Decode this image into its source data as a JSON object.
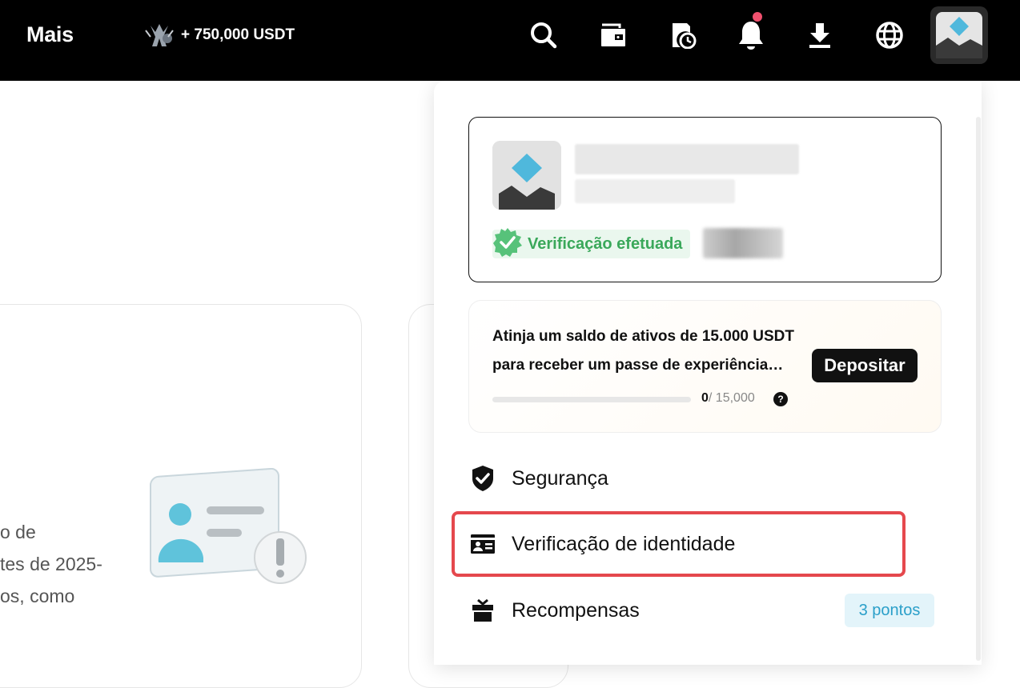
{
  "header": {
    "nav_more": "Mais",
    "promo_text": "+ 750,000 USDT",
    "icons": [
      "search-icon",
      "wallet-icon",
      "order-history-icon",
      "bell-icon",
      "download-icon",
      "globe-icon",
      "avatar"
    ],
    "notification_dot_color": "#f0506e"
  },
  "background": {
    "text_lines": [
      "o de",
      "tes de 2025-",
      "os, como"
    ]
  },
  "profile": {
    "verified_label": "Verificação efetuada",
    "verified_color": "#3aa85a"
  },
  "promo_card": {
    "line1": "Atinja um saldo de ativos de 15.000 USDT",
    "line2": "para receber um passe de experiência…",
    "button_label": "Depositar",
    "progress_current": "0",
    "progress_total": "/ 15,000",
    "progress_fraction": 0,
    "help_icon": "?"
  },
  "menu": {
    "items": [
      {
        "label": "Segurança",
        "icon": "shield-check-icon"
      },
      {
        "label": "Verificação de identidade",
        "icon": "id-card-icon"
      },
      {
        "label": "Recompensas",
        "icon": "gift-icon",
        "badge": "3 pontos"
      }
    ]
  },
  "colors": {
    "highlight": "#e5484d",
    "accent_blue": "#2a9fc9",
    "avatar_diamond": "#4fb8dc"
  }
}
